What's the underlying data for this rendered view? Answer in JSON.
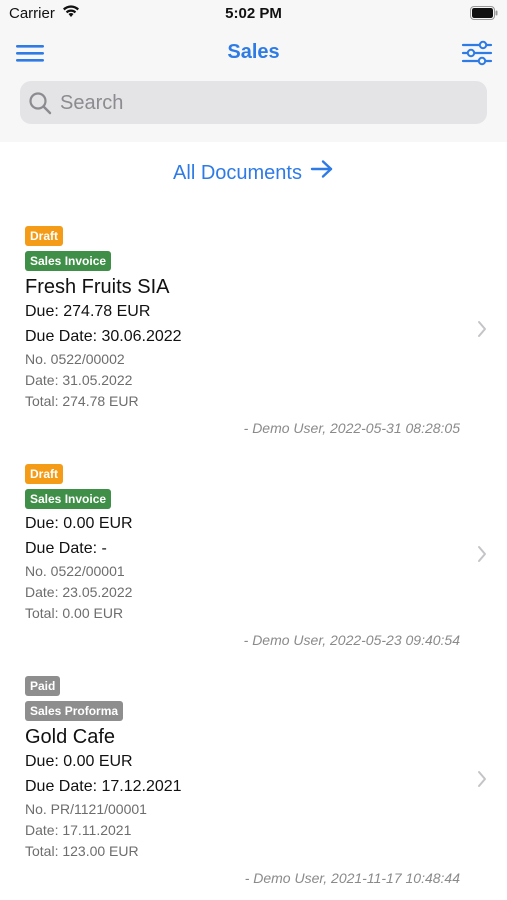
{
  "status_bar": {
    "carrier": "Carrier",
    "time": "5:02 PM"
  },
  "nav": {
    "title": "Sales"
  },
  "search": {
    "placeholder": "Search",
    "value": ""
  },
  "all_documents_link": "All Documents",
  "colors": {
    "accent": "#2f7be5",
    "draft": "#f49b17",
    "invoice": "#3f8f48",
    "paid": "#8e8e8e"
  },
  "documents": [
    {
      "status": "Draft",
      "type": "Sales Invoice",
      "customer": "Fresh Fruits SIA",
      "due": "Due: 274.78 EUR",
      "due_date": "Due Date: 30.06.2022",
      "number": "No. 0522/00002",
      "date": "Date: 31.05.2022",
      "total": "Total: 274.78 EUR",
      "created": "- Demo User, 2022-05-31 08:28:05"
    },
    {
      "status": "Draft",
      "type": "Sales Invoice",
      "customer": "",
      "due": "Due: 0.00 EUR",
      "due_date": "Due Date: -",
      "number": "No. 0522/00001",
      "date": "Date: 23.05.2022",
      "total": "Total: 0.00 EUR",
      "created": "- Demo User, 2022-05-23 09:40:54"
    },
    {
      "status": "Paid",
      "type": "Sales Proforma",
      "customer": "Gold Cafe",
      "due": "Due: 0.00 EUR",
      "due_date": "Due Date: 17.12.2021",
      "number": "No. PR/1121/00001",
      "date": "Date: 17.11.2021",
      "total": "Total: 123.00 EUR",
      "created": "- Demo User, 2021-11-17 10:48:44"
    }
  ]
}
